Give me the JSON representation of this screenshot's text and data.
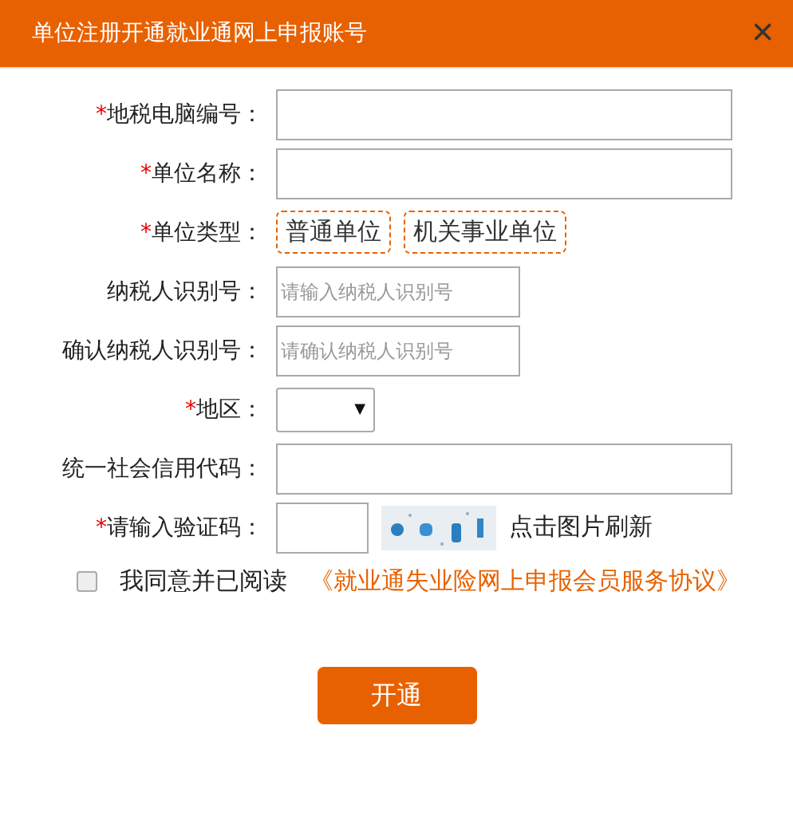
{
  "window": {
    "title": "单位注册开通就业通网上申报账号",
    "close": "×"
  },
  "fields": [
    {
      "kind": "text",
      "label": "地税电脑编号：",
      "required": true
    },
    {
      "kind": "text",
      "label": "单位名称：",
      "required": true
    },
    {
      "kind": "choice",
      "label": "单位类型：",
      "required": true,
      "options": [
        {
          "label": "普通单位",
          "selected": false
        },
        {
          "label": "机关事业单位",
          "selected": false
        }
      ]
    },
    {
      "kind": "id",
      "label": "纳税人识别号：",
      "required": false,
      "placeholder": "请输入纳税人识别号"
    },
    {
      "kind": "id",
      "label": "确认纳税人识别号：",
      "required": false,
      "placeholder": "请确认纳税人识别号"
    },
    {
      "kind": "select",
      "label": "地区：",
      "required": true,
      "arrow": "▼"
    },
    {
      "kind": "text",
      "label": "统一社会信用代码：",
      "required": false
    },
    {
      "kind": "captcha",
      "label": "请输入验证码：",
      "required": true,
      "hint": "点击图片刷新"
    }
  ],
  "required_mark": "*",
  "agreement": {
    "checked": false,
    "text": "我同意并已阅读",
    "link": "《就业通失业险网上申报会员服务协议》"
  },
  "submit": "开通"
}
